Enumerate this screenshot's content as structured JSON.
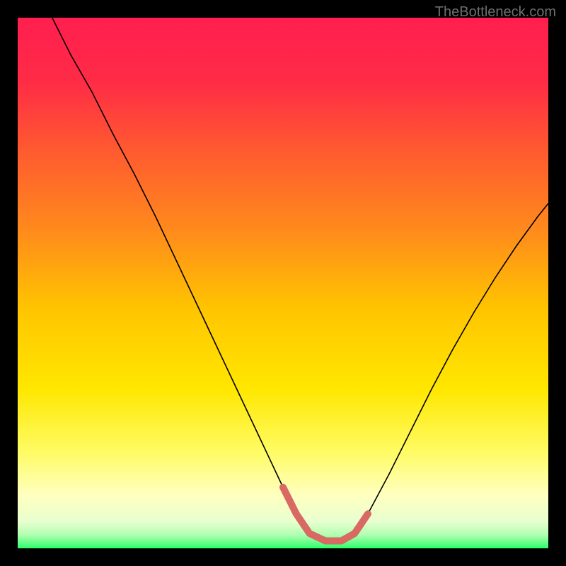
{
  "watermark": "TheBottleneck.com",
  "chart_data": {
    "type": "line",
    "title": "",
    "xlabel": "",
    "ylabel": "",
    "xlim": [
      0,
      100
    ],
    "ylim": [
      0,
      100
    ],
    "grid": false,
    "background_gradient_stops": [
      {
        "offset": 0.0,
        "color": "#ff1f4f"
      },
      {
        "offset": 0.12,
        "color": "#ff2b46"
      },
      {
        "offset": 0.25,
        "color": "#ff5a30"
      },
      {
        "offset": 0.4,
        "color": "#ff8a1c"
      },
      {
        "offset": 0.55,
        "color": "#ffc500"
      },
      {
        "offset": 0.7,
        "color": "#ffe700"
      },
      {
        "offset": 0.82,
        "color": "#fffc66"
      },
      {
        "offset": 0.9,
        "color": "#ffffc0"
      },
      {
        "offset": 0.95,
        "color": "#e8ffd0"
      },
      {
        "offset": 0.975,
        "color": "#b0ffb0"
      },
      {
        "offset": 1.0,
        "color": "#2cff6a"
      }
    ],
    "series": [
      {
        "name": "curve",
        "stroke": "#000000",
        "stroke_width": 1.6,
        "x": [
          6.5,
          10,
          14,
          18,
          22,
          26,
          30,
          34,
          38,
          42,
          46,
          50,
          52.5,
          55,
          58,
          61,
          63.5,
          66,
          70,
          74,
          78,
          82,
          86,
          90,
          94,
          98,
          100
        ],
        "y": [
          100,
          93,
          86,
          78,
          70.5,
          62.5,
          54,
          45.5,
          37,
          28.5,
          20,
          11.5,
          6.5,
          2.8,
          1.4,
          1.4,
          2.8,
          6.5,
          14,
          22,
          30,
          37.5,
          44.5,
          51,
          57,
          62.5,
          65
        ]
      },
      {
        "name": "highlight",
        "stroke": "#d86a63",
        "stroke_width": 10,
        "linecap": "round",
        "x": [
          50,
          52.5,
          55,
          58,
          61,
          63.5,
          66
        ],
        "y": [
          11.5,
          6.5,
          2.8,
          1.4,
          1.4,
          2.8,
          6.5
        ]
      }
    ],
    "annotations": []
  }
}
